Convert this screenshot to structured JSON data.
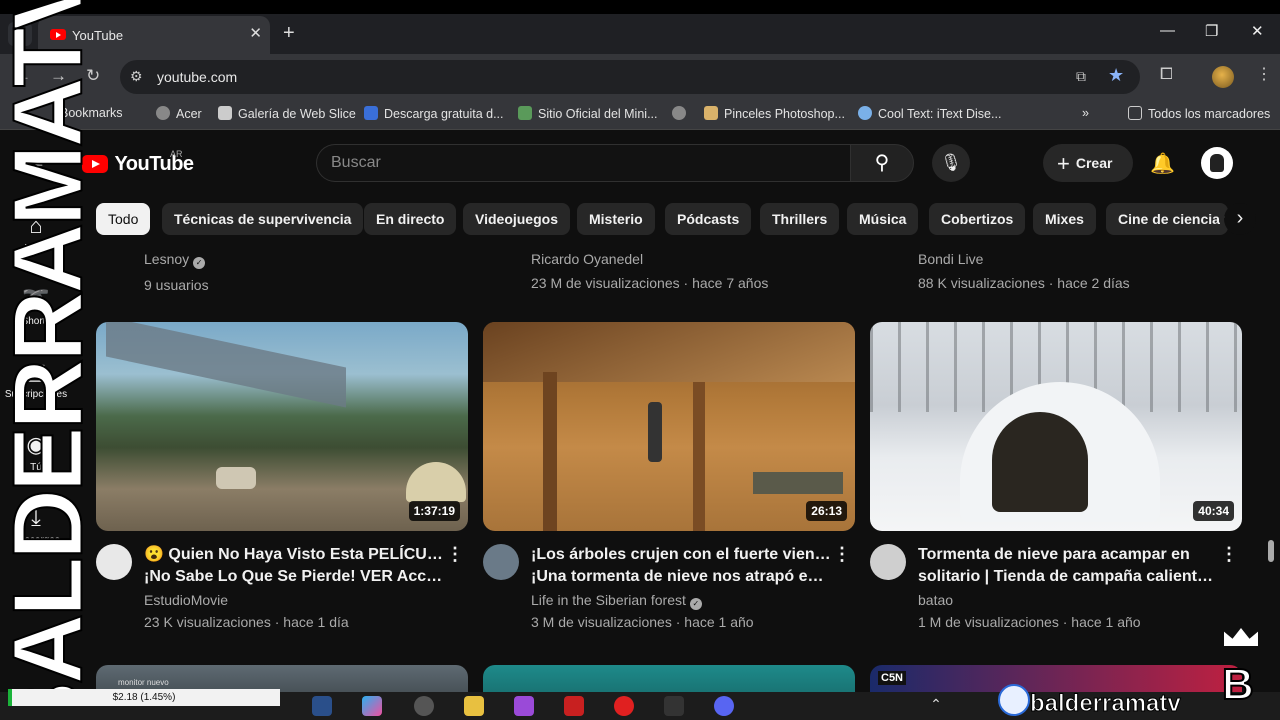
{
  "browser": {
    "tab_title": "YouTube",
    "url": "youtube.com",
    "bookmarks": [
      {
        "label": "Bookmarks"
      },
      {
        "label": "Acer"
      },
      {
        "label": "Galería de Web Slice"
      },
      {
        "label": "Descarga gratuita d..."
      },
      {
        "label": "Sitio Oficial del Mini..."
      },
      {
        "label": ""
      },
      {
        "label": "Pinceles Photoshop..."
      },
      {
        "label": "Cool Text: iText Dise..."
      }
    ],
    "all_bookmarks": "Todos los marcadores",
    "overflow": "»"
  },
  "yt": {
    "logo": "YouTube",
    "country": "AR",
    "search_placeholder": "Buscar",
    "create_label": "Crear",
    "chips": [
      "Todo",
      "Técnicas de supervivencia",
      "En directo",
      "Videojuegos",
      "Misterio",
      "Pódcasts",
      "Thrillers",
      "Música",
      "Cobertizos",
      "Mixes",
      "Cine de ciencia f"
    ],
    "sidebar": [
      {
        "label": "Inicio",
        "icon": "home-icon"
      },
      {
        "label": "Shorts",
        "icon": "shorts-icon"
      },
      {
        "label": "Suscripciones",
        "icon": "subscriptions-icon"
      },
      {
        "label": "Tú",
        "icon": "you-icon"
      },
      {
        "label": "Descargas",
        "icon": "downloads-icon"
      }
    ],
    "prev_row": [
      {
        "channel": "Lesnoy",
        "stats": "9 usuarios",
        "verified": true
      },
      {
        "channel": "Ricardo Oyanedel",
        "stats": "23 M de visualizaciones · hace 7 años",
        "verified": false
      },
      {
        "channel": "Bondi Live",
        "stats": "88 K visualizaciones · hace 2 días",
        "verified": false
      }
    ],
    "videos": [
      {
        "title1": "😮 Quien No Haya Visto Esta PELÍCULA...",
        "title2": "¡No Sabe Lo Que Se Pierde! VER Acción ...",
        "channel": "EstudioMovie",
        "stats": "23 K visualizaciones · hace 1 día",
        "duration": "1:37:19"
      },
      {
        "title1": "¡Los árboles crujen con el fuerte viento!",
        "title2": "¡Una tormenta de nieve nos atrapó en el ...",
        "channel": "Life in the Siberian forest",
        "stats": "3 M de visualizaciones · hace 1 año",
        "duration": "26:13"
      },
      {
        "title1": "Tormenta de nieve para acampar en",
        "title2": "solitario | Tienda de campaña caliente ...",
        "channel": "batao",
        "stats": "1 M de visualizaciones · hace 1 año",
        "duration": "40:34"
      }
    ],
    "row2_badges": [
      "monitor nuevo",
      "",
      "C5N"
    ]
  },
  "overlay": {
    "watermark": "BALDERRAMATV",
    "brand": "balderramatv",
    "gpu_caption": "monitor nuevo",
    "gpu_value": "$2.18 (1.45%)",
    "gpu_fraction": 0.0145
  },
  "colors": {
    "yt_red": "#ff0000",
    "bg": "#0f0f0f",
    "chip": "#272727",
    "accent": "#8ab4f8"
  }
}
